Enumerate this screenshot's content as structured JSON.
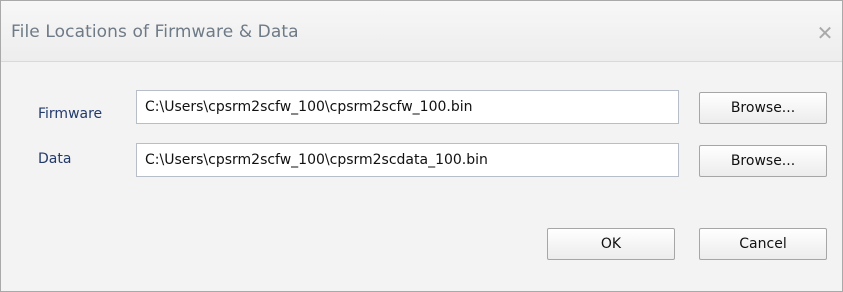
{
  "dialog": {
    "title": "File Locations of Firmware & Data",
    "close_glyph": "✕"
  },
  "fields": [
    {
      "label": "Firmware",
      "value": "C:\\Users\\cpsrm2scfw_100\\cpsrm2scfw_100.bin",
      "browse_label": "Browse..."
    },
    {
      "label": "Data",
      "value": "C:\\Users\\cpsrm2scfw_100\\cpsrm2scdata_100.bin",
      "browse_label": "Browse..."
    }
  ],
  "actions": {
    "ok_label": "OK",
    "cancel_label": "Cancel"
  },
  "icons": {
    "close": "close-icon"
  }
}
